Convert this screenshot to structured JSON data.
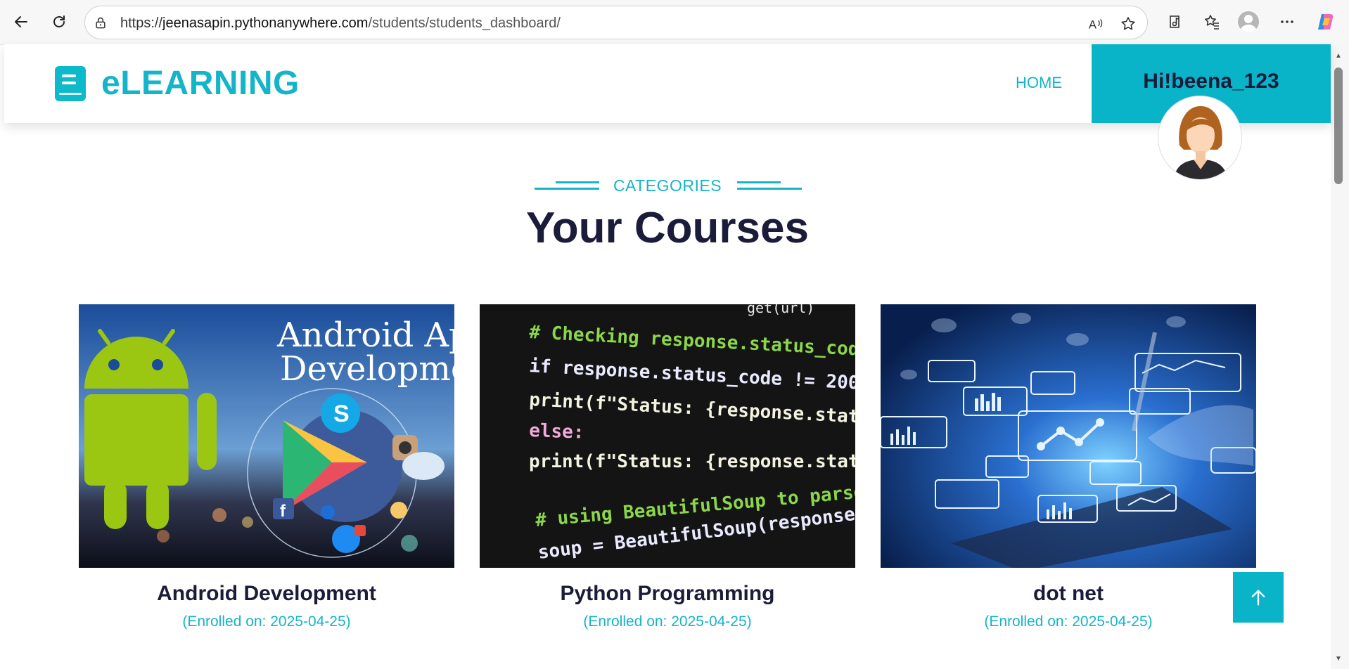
{
  "browser": {
    "url_protocol": "https://",
    "url_host": "jeenasapin.pythonanywhere.com",
    "url_path": "/students/students_dashboard/"
  },
  "header": {
    "logo_text": "eLEARNING",
    "nav_home": "HOME",
    "greeting": "Hi!beena_123"
  },
  "section": {
    "eyebrow": "CATEGORIES",
    "title": "Your Courses"
  },
  "courses": [
    {
      "title": "Android Development",
      "enrolled": "(Enrolled on: 2025-04-25)",
      "image_text_1": "Android App",
      "image_text_2": "Development"
    },
    {
      "title": "Python Programming",
      "enrolled": "(Enrolled on: 2025-04-25)"
    },
    {
      "title": "dot net",
      "enrolled": "(Enrolled on: 2025-04-25)"
    }
  ],
  "code_lines": [
    "# Checking response.status_code (i",
    "if response.status_code != 200:",
    "    print(f\"Status: {response.statu",
    "else:",
    "    print(f\"Status: {response.statu",
    "# using BeautifulSoup to parse the",
    "soup = BeautifulSoup(response.conte"
  ],
  "colors": {
    "accent": "#14b4c9",
    "dark_text": "#1b1b3a",
    "user_box": "#09b4c9"
  }
}
